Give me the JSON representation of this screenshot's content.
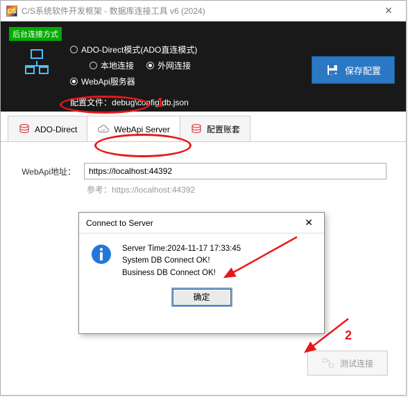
{
  "titlebar": {
    "title": "C/S系统软件开发框架 - 数据库连接工具 v6 (2024)"
  },
  "top": {
    "green_label": "后台连接方式",
    "radio_ado": "ADO-Direct模式(ADO直连模式)",
    "radio_local": "本地连接",
    "radio_external": "外网连接",
    "radio_webapi": "WebApi服务器",
    "config_prefix": "配置文件：",
    "config_path": "debug\\config\\db.json",
    "save_label": "保存配置"
  },
  "tabs": {
    "t0": "ADO-Direct",
    "t1": "WebApi Server",
    "t2": "配置账套"
  },
  "form": {
    "addr_label": "WebApi地址：",
    "addr_value": "https://localhost:44392",
    "hint": "参考：https://localhost:44392",
    "test_label": "测试连接"
  },
  "dialog": {
    "title": "Connect to Server",
    "body": "Server Time:2024-11-17 17:33:45\nSystem DB Connect OK!\nBusiness DB Connect OK!",
    "ok": "确定"
  },
  "anno": {
    "n1": "1",
    "n2": "2"
  }
}
